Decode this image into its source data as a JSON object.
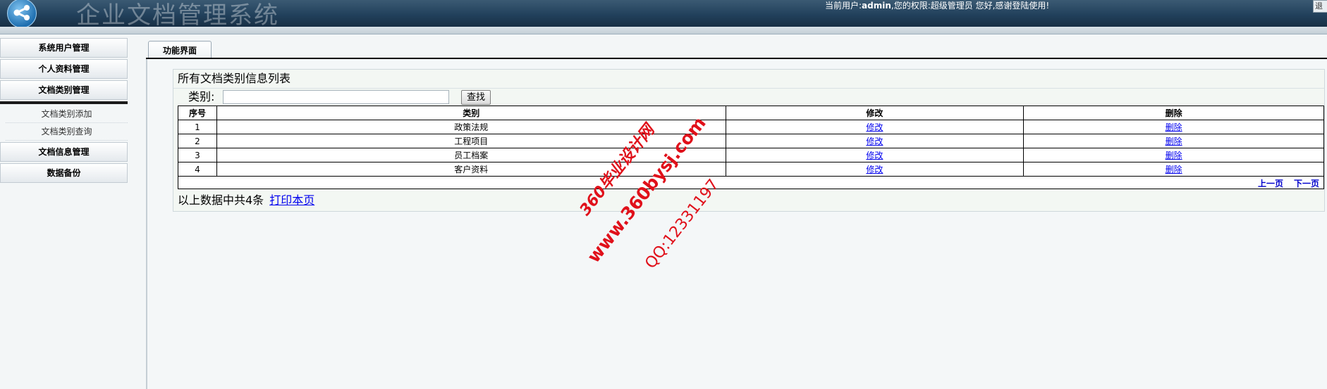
{
  "header": {
    "app_title": "企业文档管理系统",
    "user_prefix": "当前用户:",
    "username": "admin",
    "user_suffix": ",您的权限:超级管理员 您好,感谢登陆使用!",
    "logout_label": "退出"
  },
  "sidebar": {
    "items": [
      {
        "label": "系统用户管理"
      },
      {
        "label": "个人资料管理"
      },
      {
        "label": "文档类别管理"
      },
      {
        "label": "文档信息管理"
      },
      {
        "label": "数据备份"
      }
    ],
    "submenu": [
      {
        "label": "文档类别添加"
      },
      {
        "label": "文档类别查询"
      }
    ]
  },
  "main": {
    "tab_label": "功能界面",
    "panel_title": "所有文档类别信息列表",
    "filter": {
      "label": "类别:",
      "value": "",
      "button_label": "查找"
    },
    "table": {
      "headers": [
        "序号",
        "类别",
        "修改",
        "删除"
      ],
      "rows": [
        {
          "no": "1",
          "category": "政策法规",
          "edit": "修改",
          "delete": "删除"
        },
        {
          "no": "2",
          "category": "工程项目",
          "edit": "修改",
          "delete": "删除"
        },
        {
          "no": "3",
          "category": "员工档案",
          "edit": "修改",
          "delete": "删除"
        },
        {
          "no": "4",
          "category": "客户资料",
          "edit": "修改",
          "delete": "删除"
        }
      ]
    },
    "pager": {
      "prev_label": "上一页",
      "next_label": "下一页"
    },
    "summary": {
      "text": "以上数据中共4条",
      "print_label": "打印本页"
    }
  },
  "watermark": {
    "line1": "360毕业设计网",
    "line2": "www.360bysj.com",
    "line3": "QQ:12331197"
  },
  "colors": {
    "header_bg": "#22415c",
    "link": "#0000ee",
    "watermark": "#e0101a"
  }
}
